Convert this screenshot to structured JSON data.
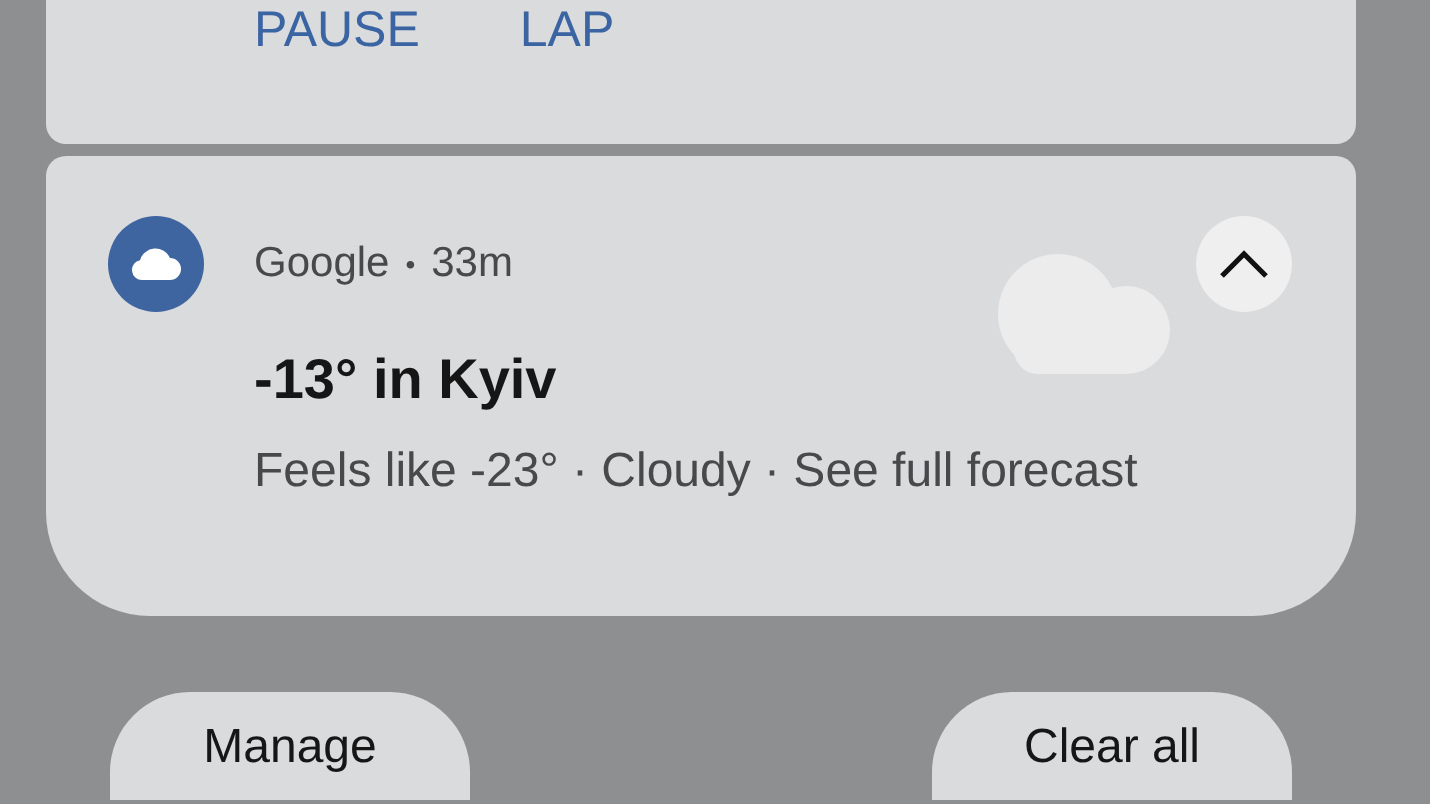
{
  "media_notification": {
    "actions": [
      "PAUSE",
      "LAP"
    ]
  },
  "weather_notification": {
    "app": "Google",
    "separator": "•",
    "time": "33m",
    "expanded": true,
    "title": "-13° in Kyiv",
    "text": "Feels like -23° · Cloudy · See full forecast"
  },
  "buttons": [
    "Manage",
    "Clear all"
  ]
}
